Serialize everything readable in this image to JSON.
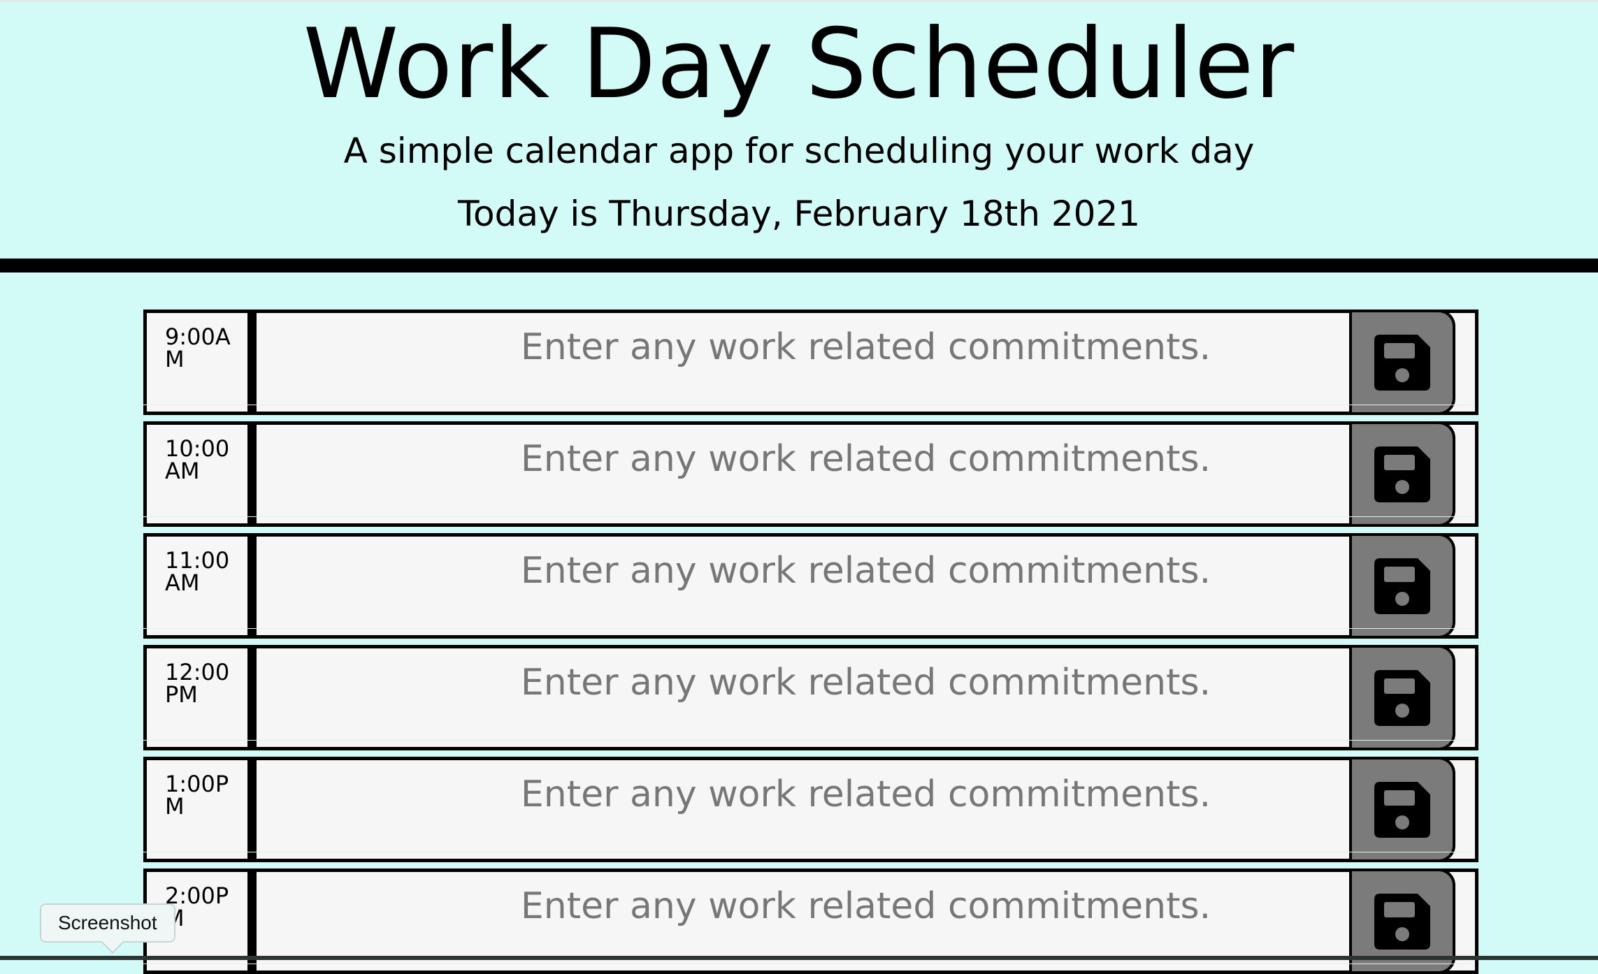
{
  "header": {
    "title": "Work Day Scheduler",
    "lead": "A simple calendar app for scheduling your work day",
    "current_day": "Today is Thursday, February 18th 2021"
  },
  "schedule": {
    "placeholder": "Enter any work related commitments.",
    "save_icon": "floppy-disk-icon",
    "rows": [
      {
        "hour": "9:00AM"
      },
      {
        "hour": "10:00 AM"
      },
      {
        "hour": "11:00 AM"
      },
      {
        "hour": "12:00 PM"
      },
      {
        "hour": "1:00PM"
      },
      {
        "hour": "2:00PM"
      }
    ]
  },
  "tooltip": {
    "label": "Screenshot"
  },
  "colors": {
    "background": "#d2fbf7",
    "block": "#f6f6f6",
    "save_button": "#7b7b7b",
    "border": "#000000"
  }
}
